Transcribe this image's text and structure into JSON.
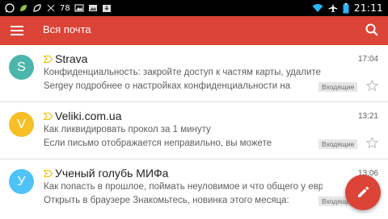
{
  "status_bar": {
    "battery_level": "78",
    "time": "21:11",
    "icons": [
      "whatsapp-icon",
      "leaf-icon",
      "missed-call-icon",
      "battery-status-icon",
      "image-icon",
      "image-icon",
      "download-icon",
      "wifi-icon",
      "airplane-icon",
      "battery-icon"
    ]
  },
  "app_bar": {
    "title": "Вся почта",
    "menu_icon": "menu-icon",
    "search_icon": "search-icon",
    "color": "#db4437"
  },
  "emails": [
    {
      "avatar_letter": "S",
      "avatar_color": "#4db6ac",
      "sender": "Strava",
      "time": "17:04",
      "subject": "Конфиденциальность: закройте доступ к частям карты, удалите",
      "snippet": "Sergey подробнее о настройках конфиденциальности на",
      "label": "Входящие",
      "starred": false
    },
    {
      "avatar_letter": "V",
      "avatar_color": "#f6bf26",
      "sender": "Veliki.com.ua",
      "time": "13:21",
      "subject": "Как ликвидировать прокол за 1 минуту",
      "snippet": "Если письмо отображается неправильно, вы можете",
      "label": "Входящие",
      "starred": false
    },
    {
      "avatar_letter": "У",
      "avatar_color": "#4fc3f7",
      "sender": "Ученый голубь МИФа",
      "time": "13:06",
      "subject": "Как попасть в прошлое, поймать неуловимое и что общего у евр",
      "snippet": "Открыть в браузере Знакомьтесь, новинка этого месяца:",
      "label": "Входящие",
      "starred": false
    }
  ],
  "fab": {
    "icon": "pencil-icon",
    "color": "#db4437"
  }
}
